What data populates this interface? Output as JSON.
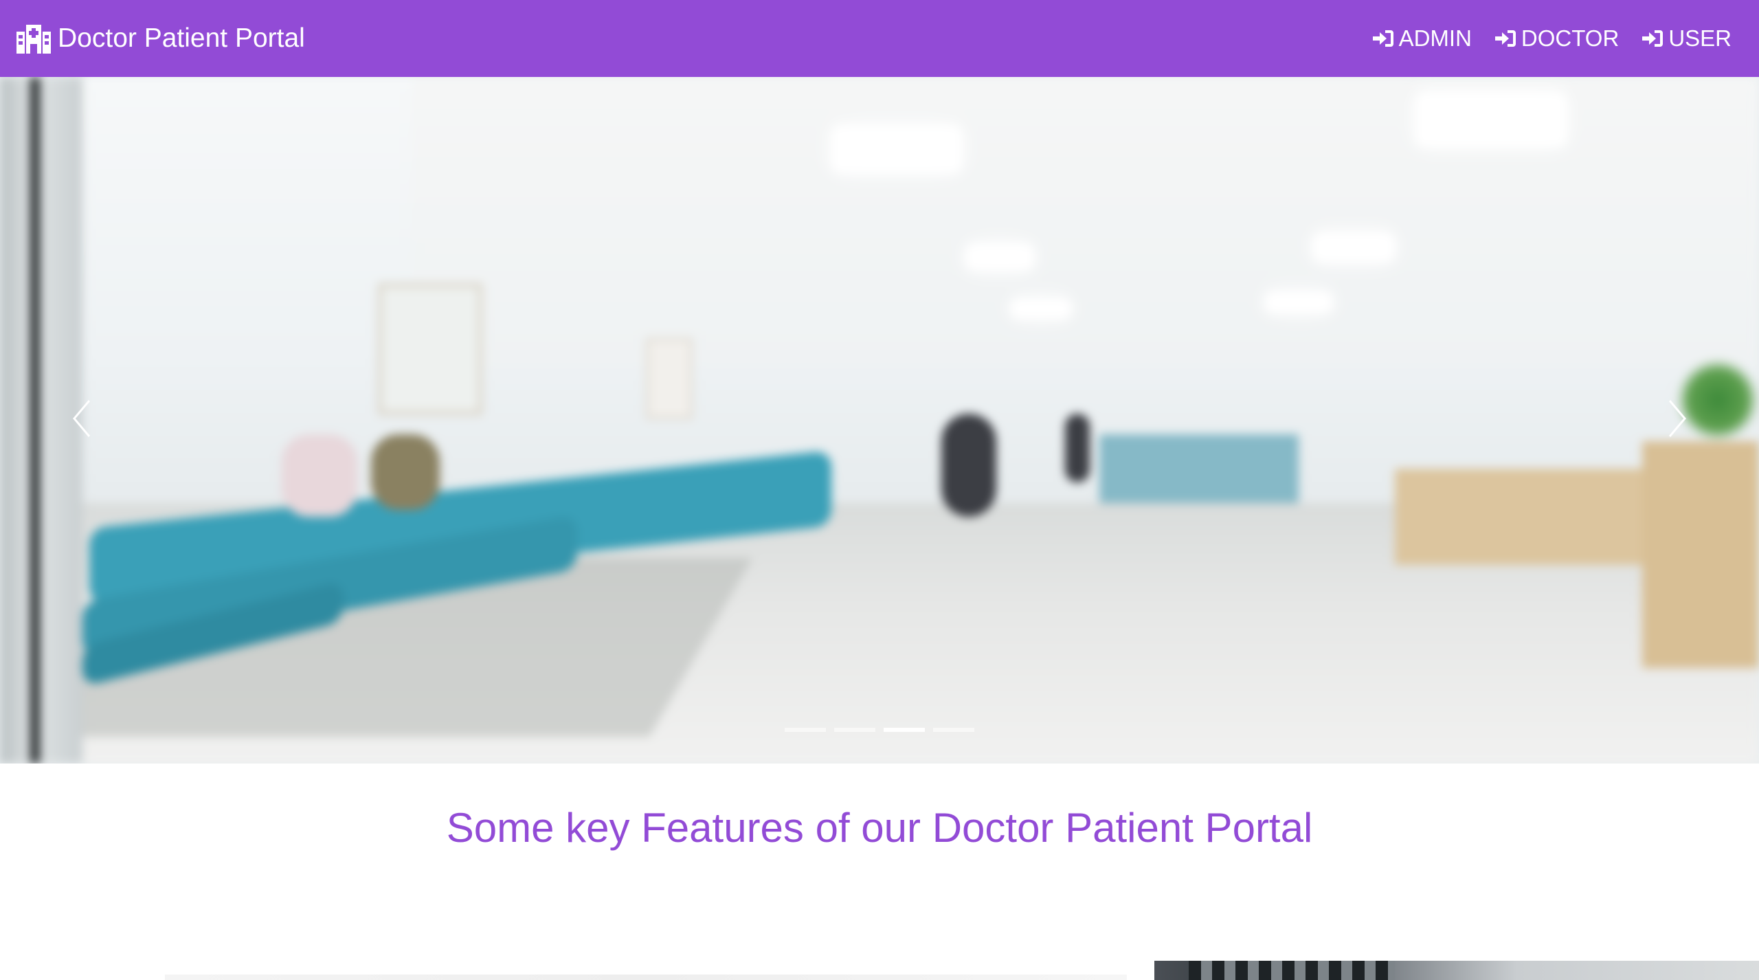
{
  "brand": {
    "title": "Doctor Patient Portal",
    "icon": "hospital-icon"
  },
  "nav": {
    "links": [
      {
        "label": "ADMIN",
        "icon": "sign-in-icon"
      },
      {
        "label": "DOCTOR",
        "icon": "sign-in-icon"
      },
      {
        "label": "USER",
        "icon": "sign-in-icon"
      }
    ]
  },
  "carousel": {
    "slide_count": 4,
    "active_index": 3,
    "prev_icon": "chevron-left-icon",
    "next_icon": "chevron-right-icon"
  },
  "features": {
    "heading": "Some key Features of our Doctor Patient Portal"
  },
  "colors": {
    "navbar": "#924bd6",
    "heading": "#924bd6",
    "chairs": "#3aa0b8"
  }
}
